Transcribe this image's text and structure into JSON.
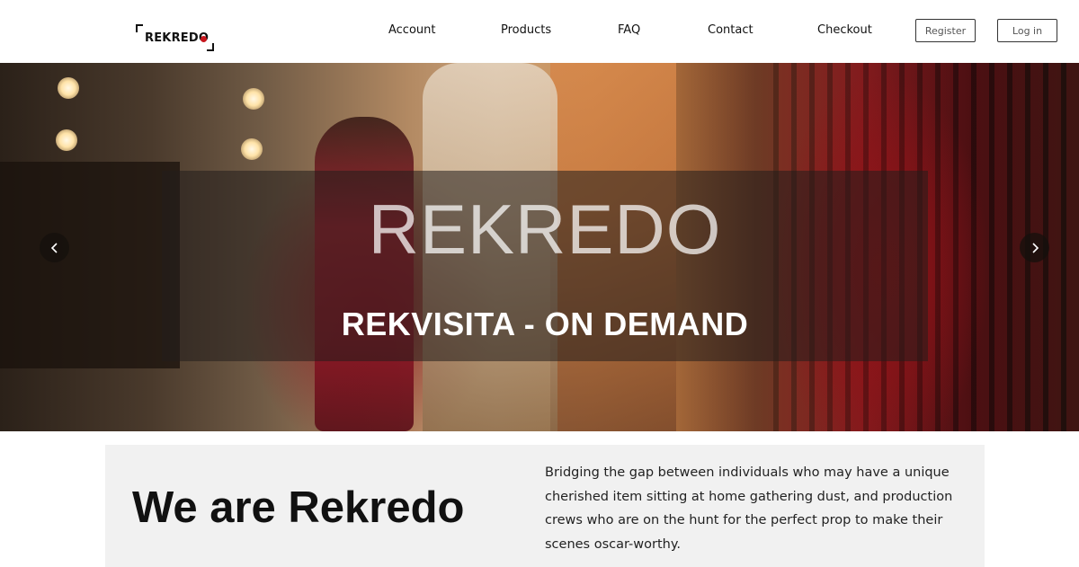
{
  "header": {
    "logo_text": "REKREDO",
    "nav": [
      "Account",
      "Products",
      "FAQ",
      "Contact",
      "Checkout"
    ],
    "register_label": "Register",
    "login_label": "Log in"
  },
  "hero": {
    "title": "REKREDO",
    "subtitle": "REKVISITA - ON DEMAND",
    "prev_icon": "chevron-left-icon",
    "next_icon": "chevron-right-icon"
  },
  "about": {
    "title": "We are Rekredo",
    "text": "Bridging the gap between individuals who may have a unique cherished item sitting at home gathering dust, and production crews who are on the hunt for the perfect prop to make their scenes oscar-worthy."
  },
  "colors": {
    "logo_accent": "#c8161d",
    "section_bg": "#f1f1f1"
  }
}
